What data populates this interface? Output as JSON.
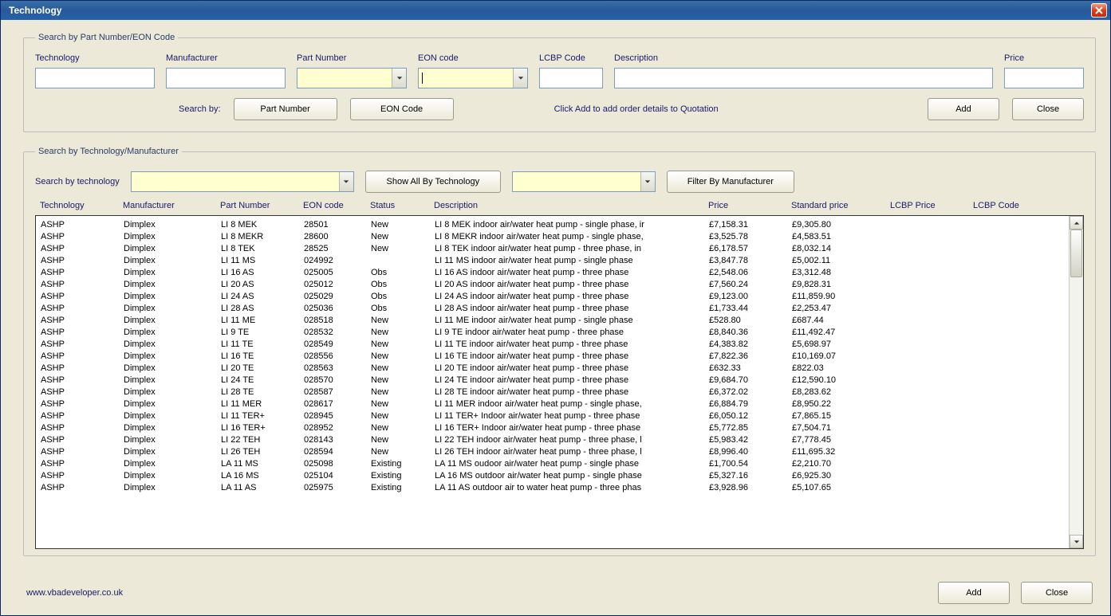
{
  "window": {
    "title": "Technology"
  },
  "group1": {
    "legend": "Search by Part Number/EON Code",
    "labels": {
      "technology": "Technology",
      "manufacturer": "Manufacturer",
      "partnumber": "Part Number",
      "eoncode": "EON code",
      "lcbpcode": "LCBP Code",
      "description": "Description",
      "price": "Price"
    },
    "values": {
      "technology": "",
      "manufacturer": "",
      "partnumber": "",
      "eoncode": "",
      "lcbpcode": "",
      "description": "",
      "price": ""
    },
    "searchby_label": "Search by:",
    "btn_partnumber": "Part Number",
    "btn_eoncode": "EON Code",
    "hint": "Click Add to add order details to Quotation",
    "btn_add": "Add",
    "btn_close": "Close"
  },
  "group2": {
    "legend": "Search by Technology/Manufacturer",
    "searchby_tech_label": "Search by technology",
    "tech_combo": "",
    "btn_show_all": "Show All By Technology",
    "manu_combo": "",
    "btn_filter_manu": "Filter By Manufacturer",
    "headers": {
      "technology": "Technology",
      "manufacturer": "Manufacturer",
      "partnumber": "Part Number",
      "eoncode": "EON code",
      "status": "Status",
      "description": "Description",
      "price": "Price",
      "stdprice": "Standard price",
      "lcbpprice": "LCBP Price",
      "lcbpcode": "LCBP Code"
    },
    "rows": [
      {
        "technology": "ASHP",
        "manufacturer": "Dimplex",
        "partnumber": "LI 8 MEK",
        "eoncode": "28501",
        "status": "New",
        "description": "LI 8 MEK indoor air/water heat pump - single phase, ir",
        "price": "£7,158.31",
        "stdprice": "£9,305.80",
        "lcbpprice": "",
        "lcbpcode": ""
      },
      {
        "technology": "ASHP",
        "manufacturer": "Dimplex",
        "partnumber": "LI 8 MEKR",
        "eoncode": "28600",
        "status": "New",
        "description": "LI 8 MEKR indoor air/water heat pump - single phase,",
        "price": "£3,525.78",
        "stdprice": "£4,583.51",
        "lcbpprice": "",
        "lcbpcode": ""
      },
      {
        "technology": "ASHP",
        "manufacturer": "Dimplex",
        "partnumber": "LI 8 TEK",
        "eoncode": "28525",
        "status": "New",
        "description": "LI 8 TEK indoor air/water heat pump - three phase, in",
        "price": "£6,178.57",
        "stdprice": "£8,032.14",
        "lcbpprice": "",
        "lcbpcode": ""
      },
      {
        "technology": "ASHP",
        "manufacturer": "Dimplex",
        "partnumber": "LI 11 MS",
        "eoncode": "024992",
        "status": "",
        "description": "LI 11 MS indoor air/water heat pump - single phase",
        "price": "£3,847.78",
        "stdprice": "£5,002.11",
        "lcbpprice": "",
        "lcbpcode": ""
      },
      {
        "technology": "ASHP",
        "manufacturer": "Dimplex",
        "partnumber": "LI 16 AS",
        "eoncode": "025005",
        "status": "Obs",
        "description": "LI 16 AS indoor air/water heat pump - three phase",
        "price": "£2,548.06",
        "stdprice": "£3,312.48",
        "lcbpprice": "",
        "lcbpcode": ""
      },
      {
        "technology": "ASHP",
        "manufacturer": "Dimplex",
        "partnumber": "LI 20 AS",
        "eoncode": "025012",
        "status": "Obs",
        "description": "LI 20 AS indoor air/water heat pump - three phase",
        "price": "£7,560.24",
        "stdprice": "£9,828.31",
        "lcbpprice": "",
        "lcbpcode": ""
      },
      {
        "technology": "ASHP",
        "manufacturer": "Dimplex",
        "partnumber": "LI 24 AS",
        "eoncode": "025029",
        "status": "Obs",
        "description": "LI 24 AS indoor air/water heat pump - three phase",
        "price": "£9,123.00",
        "stdprice": "£11,859.90",
        "lcbpprice": "",
        "lcbpcode": ""
      },
      {
        "technology": "ASHP",
        "manufacturer": "Dimplex",
        "partnumber": "LI 28 AS",
        "eoncode": "025036",
        "status": "Obs",
        "description": "LI 28 AS indoor air/water heat pump - three phase",
        "price": "£1,733.44",
        "stdprice": "£2,253.47",
        "lcbpprice": "",
        "lcbpcode": ""
      },
      {
        "technology": "ASHP",
        "manufacturer": "Dimplex",
        "partnumber": "LI 11 ME",
        "eoncode": "028518",
        "status": "New",
        "description": "LI 11 ME indoor air/water heat pump - single phase",
        "price": "£528.80",
        "stdprice": "£687.44",
        "lcbpprice": "",
        "lcbpcode": ""
      },
      {
        "technology": "ASHP",
        "manufacturer": "Dimplex",
        "partnumber": "LI 9 TE",
        "eoncode": "028532",
        "status": "New",
        "description": "LI 9 TE indoor air/water heat pump - three phase",
        "price": "£8,840.36",
        "stdprice": "£11,492.47",
        "lcbpprice": "",
        "lcbpcode": ""
      },
      {
        "technology": "ASHP",
        "manufacturer": "Dimplex",
        "partnumber": "LI 11 TE",
        "eoncode": "028549",
        "status": "New",
        "description": "LI 11 TE indoor air/water heat pump - three phase",
        "price": "£4,383.82",
        "stdprice": "£5,698.97",
        "lcbpprice": "",
        "lcbpcode": ""
      },
      {
        "technology": "ASHP",
        "manufacturer": "Dimplex",
        "partnumber": "LI 16 TE",
        "eoncode": "028556",
        "status": "New",
        "description": "LI 16 TE indoor air/water heat pump - three phase",
        "price": "£7,822.36",
        "stdprice": "£10,169.07",
        "lcbpprice": "",
        "lcbpcode": ""
      },
      {
        "technology": "ASHP",
        "manufacturer": "Dimplex",
        "partnumber": "LI 20 TE",
        "eoncode": "028563",
        "status": "New",
        "description": "LI 20 TE indoor air/water heat pump - three phase",
        "price": "£632.33",
        "stdprice": "£822.03",
        "lcbpprice": "",
        "lcbpcode": ""
      },
      {
        "technology": "ASHP",
        "manufacturer": "Dimplex",
        "partnumber": "LI 24 TE",
        "eoncode": "028570",
        "status": "New",
        "description": "LI 24 TE indoor air/water heat pump - three phase",
        "price": "£9,684.70",
        "stdprice": "£12,590.10",
        "lcbpprice": "",
        "lcbpcode": ""
      },
      {
        "technology": "ASHP",
        "manufacturer": "Dimplex",
        "partnumber": "LI 28 TE",
        "eoncode": "028587",
        "status": "New",
        "description": "LI 28 TE indoor air/water heat pump - three phase",
        "price": "£6,372.02",
        "stdprice": "£8,283.62",
        "lcbpprice": "",
        "lcbpcode": ""
      },
      {
        "technology": "ASHP",
        "manufacturer": "Dimplex",
        "partnumber": "LI 11 MER",
        "eoncode": "028617",
        "status": "New",
        "description": "LI 11 MER indoor air/water heat pump - single phase,",
        "price": "£6,884.79",
        "stdprice": "£8,950.22",
        "lcbpprice": "",
        "lcbpcode": ""
      },
      {
        "technology": "ASHP",
        "manufacturer": "Dimplex",
        "partnumber": "LI 11 TER+",
        "eoncode": "028945",
        "status": "New",
        "description": "LI 11 TER+ Indoor air/water heat pump - three phase",
        "price": "£6,050.12",
        "stdprice": "£7,865.15",
        "lcbpprice": "",
        "lcbpcode": ""
      },
      {
        "technology": "ASHP",
        "manufacturer": "Dimplex",
        "partnumber": "LI 16 TER+",
        "eoncode": "028952",
        "status": "New",
        "description": "LI 16 TER+ Indoor air/water heat pump - three phase",
        "price": "£5,772.85",
        "stdprice": "£7,504.71",
        "lcbpprice": "",
        "lcbpcode": ""
      },
      {
        "technology": "ASHP",
        "manufacturer": "Dimplex",
        "partnumber": "LI 22 TEH",
        "eoncode": "028143",
        "status": "New",
        "description": "LI 22 TEH indoor air/water heat pump - three phase, l",
        "price": "£5,983.42",
        "stdprice": "£7,778.45",
        "lcbpprice": "",
        "lcbpcode": ""
      },
      {
        "technology": "ASHP",
        "manufacturer": "Dimplex",
        "partnumber": "LI 26 TEH",
        "eoncode": "028594",
        "status": "New",
        "description": "LI 26 TEH indoor air/water heat pump - three phase, l",
        "price": "£8,996.40",
        "stdprice": "£11,695.32",
        "lcbpprice": "",
        "lcbpcode": ""
      },
      {
        "technology": "ASHP",
        "manufacturer": "Dimplex",
        "partnumber": "LA 11 MS",
        "eoncode": "025098",
        "status": "Existing",
        "description": "LA 11 MS oudoor air/water heat pump - single phase",
        "price": "£1,700.54",
        "stdprice": "£2,210.70",
        "lcbpprice": "",
        "lcbpcode": ""
      },
      {
        "technology": "ASHP",
        "manufacturer": "Dimplex",
        "partnumber": "LA 16 MS",
        "eoncode": "025104",
        "status": "Existing",
        "description": "LA 16 MS outdoor air/water heat pump - single phase",
        "price": "£5,327.16",
        "stdprice": "£6,925.30",
        "lcbpprice": "",
        "lcbpcode": ""
      },
      {
        "technology": "ASHP",
        "manufacturer": "Dimplex",
        "partnumber": "LA 11 AS",
        "eoncode": "025975",
        "status": "Existing",
        "description": "LA 11 AS outdoor air to water heat pump - three phas",
        "price": "£3,928.96",
        "stdprice": "£5,107.65",
        "lcbpprice": "",
        "lcbpcode": ""
      }
    ]
  },
  "footer": {
    "link": "www.vbadeveloper.co.uk",
    "btn_add": "Add",
    "btn_close": "Close"
  }
}
